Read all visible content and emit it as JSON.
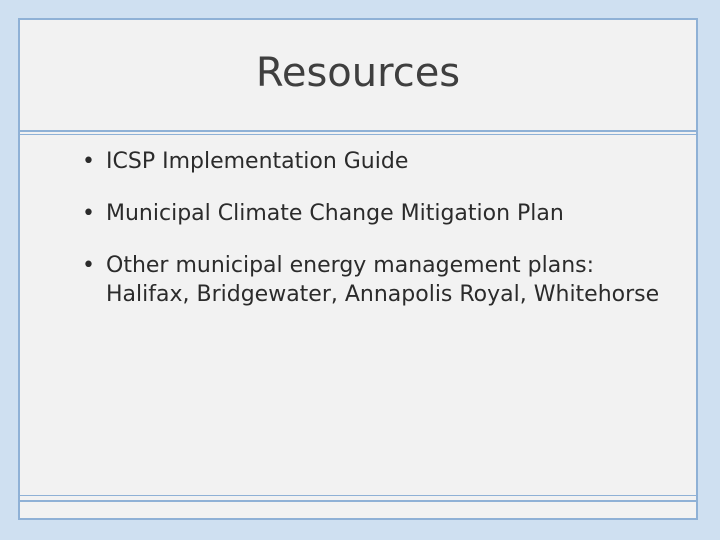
{
  "slide": {
    "title": "Resources",
    "bullets": [
      "ICSP Implementation Guide",
      "Municipal Climate Change Mitigation Plan",
      "Other municipal energy management plans: Halifax, Bridgewater, Annapolis Royal, Whitehorse"
    ],
    "bullet_glyph": "•",
    "colors": {
      "frame": "#cfe0f1",
      "border": "#8fb1d6",
      "slide_background": "#f2f2f2",
      "title_text": "#3f3f3f",
      "body_text": "#2b2b2b"
    }
  }
}
